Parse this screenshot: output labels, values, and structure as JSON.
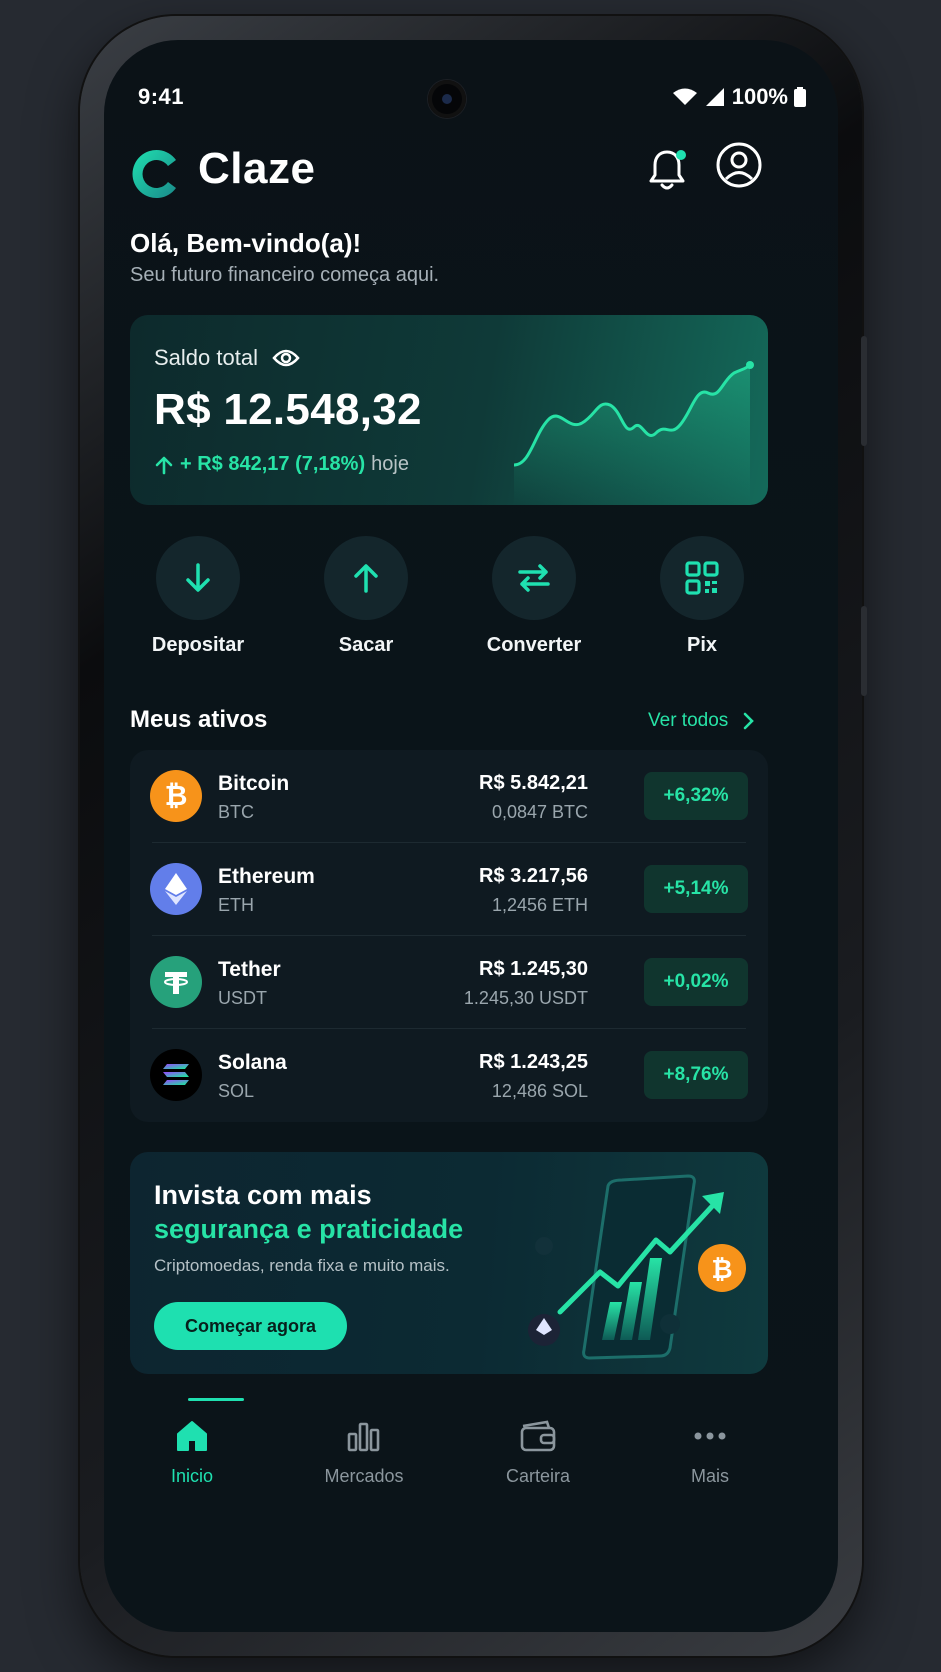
{
  "status_bar": {
    "time": "9:41",
    "battery": "100%"
  },
  "header": {
    "app_name": "Claze"
  },
  "greeting": {
    "title": "Olá, Bem-vindo(a)!",
    "subtitle": "Seu futuro financeiro começa aqui."
  },
  "balance": {
    "label": "Saldo total",
    "value": "R$ 12.548,32",
    "change": "+ R$ 842,17 (7,18%)",
    "change_period": "hoje"
  },
  "actions": [
    {
      "label": "Depositar",
      "icon": "arrow-down-icon"
    },
    {
      "label": "Sacar",
      "icon": "arrow-up-icon"
    },
    {
      "label": "Converter",
      "icon": "swap-icon"
    },
    {
      "label": "Pix",
      "icon": "qr-code-icon"
    }
  ],
  "assets": {
    "title": "Meus ativos",
    "see_all": "Ver todos",
    "items": [
      {
        "name": "Bitcoin",
        "ticker": "BTC",
        "value": "R$ 5.842,21",
        "quantity": "0,0847 BTC",
        "change": "+6,32%",
        "color": "#f7931a"
      },
      {
        "name": "Ethereum",
        "ticker": "ETH",
        "value": "R$ 3.217,56",
        "quantity": "1,2456 ETH",
        "change": "+5,14%",
        "color": "#627eea"
      },
      {
        "name": "Tether",
        "ticker": "USDT",
        "value": "R$ 1.245,30",
        "quantity": "1.245,30 USDT",
        "change": "+0,02%",
        "color": "#26a17b"
      },
      {
        "name": "Solana",
        "ticker": "SOL",
        "value": "R$ 1.243,25",
        "quantity": "12,486 SOL",
        "change": "+8,76%",
        "color": "#000000"
      }
    ]
  },
  "promo": {
    "title_line1": "Invista com mais",
    "title_line2": "segurança e praticidade",
    "subtitle": "Criptomoedas, renda fixa e muito mais.",
    "cta": "Começar agora"
  },
  "bottom_nav": [
    {
      "label": "Inicio",
      "icon": "home-icon",
      "active": true
    },
    {
      "label": "Mercados",
      "icon": "bar-chart-icon",
      "active": false
    },
    {
      "label": "Carteira",
      "icon": "wallet-icon",
      "active": false
    },
    {
      "label": "Mais",
      "icon": "more-icon",
      "active": false
    }
  ],
  "colors": {
    "accent": "#1fe0b0",
    "positive": "#27e3a6",
    "background": "#0b1419"
  }
}
